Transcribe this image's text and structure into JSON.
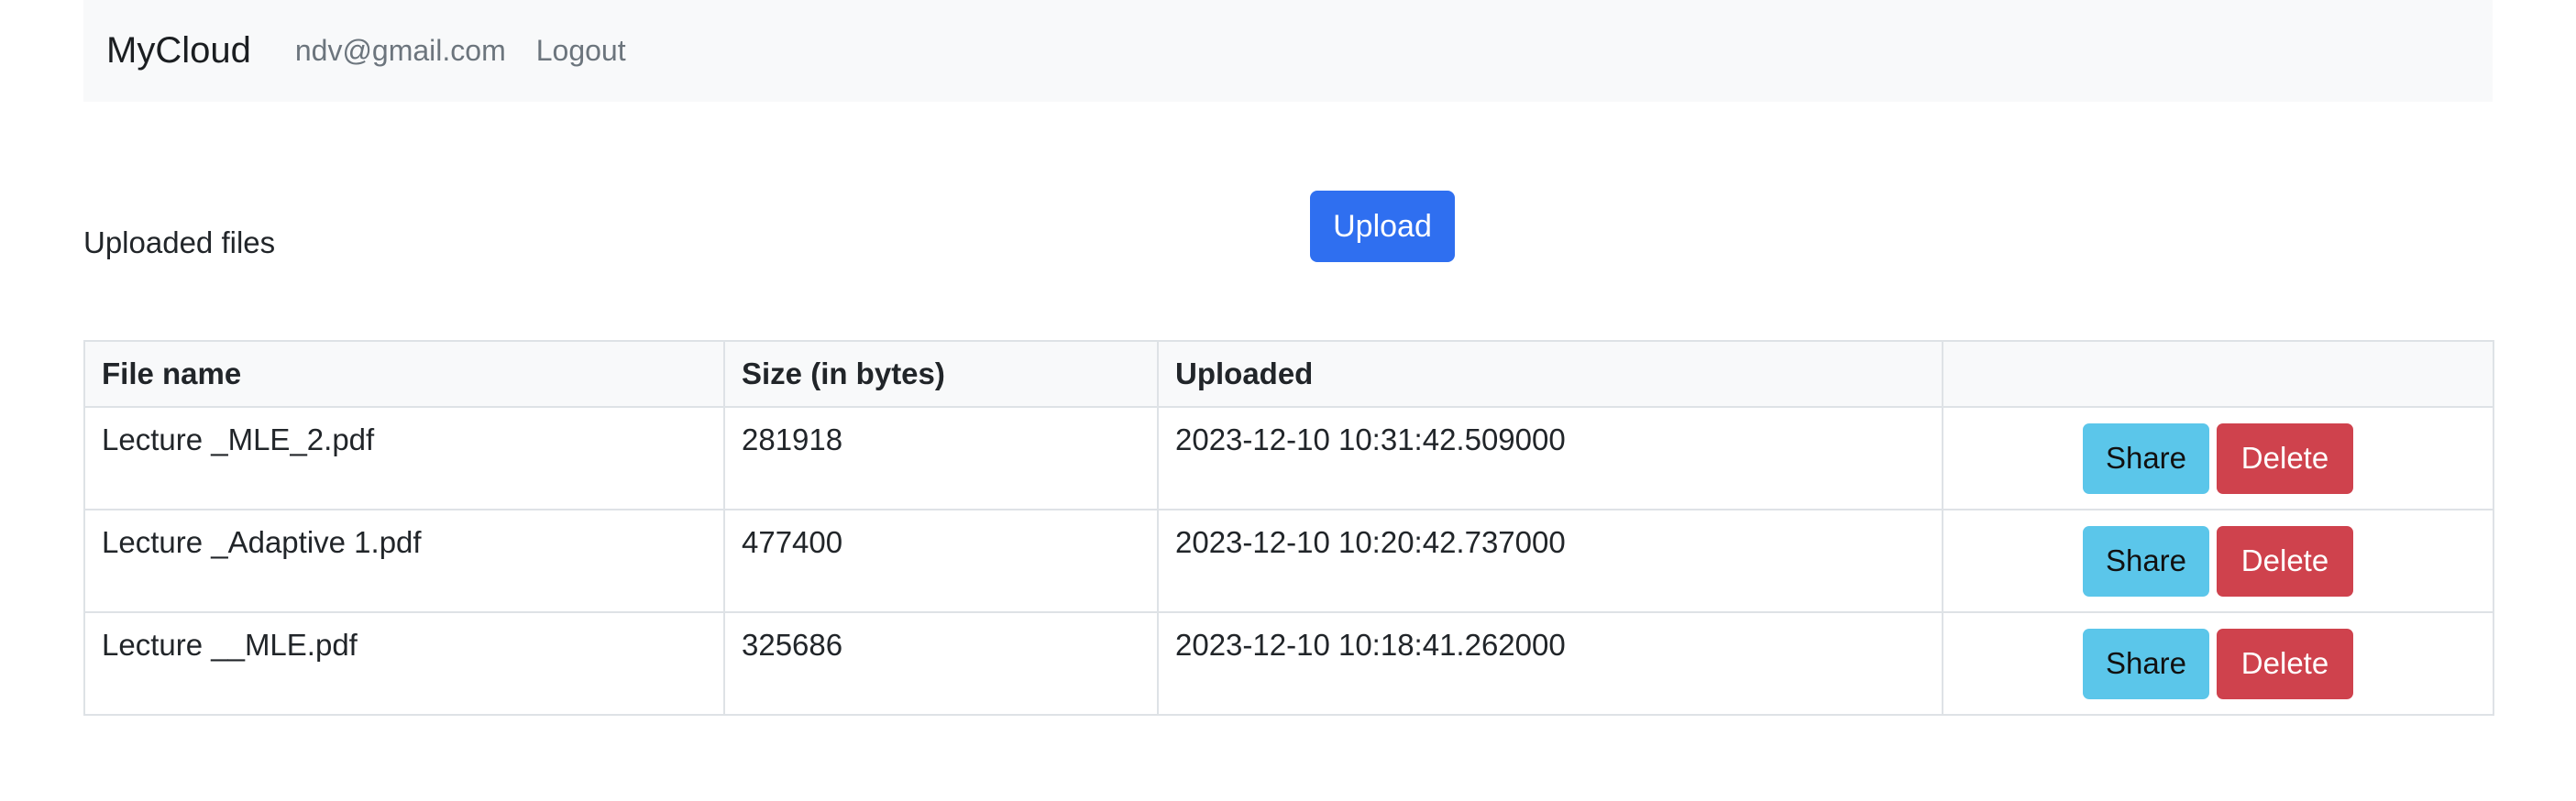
{
  "navbar": {
    "brand": "MyCloud",
    "user_email": "ndv@gmail.com",
    "logout_label": "Logout"
  },
  "main": {
    "section_title": "Uploaded files",
    "upload_label": "Upload"
  },
  "table": {
    "headers": {
      "name": "File name",
      "size": "Size (in bytes)",
      "uploaded": "Uploaded",
      "actions": ""
    },
    "rows": [
      {
        "name": "Lecture _MLE_2.pdf",
        "size": "281918",
        "uploaded": "2023-12-10 10:31:42.509000"
      },
      {
        "name": "Lecture _Adaptive 1.pdf",
        "size": "477400",
        "uploaded": "2023-12-10 10:20:42.737000"
      },
      {
        "name": "Lecture __MLE.pdf",
        "size": "325686",
        "uploaded": "2023-12-10 10:18:41.262000"
      }
    ],
    "share_label": "Share",
    "delete_label": "Delete"
  },
  "colors": {
    "primary": "#2f6ff0",
    "info": "#5bc6ea",
    "danger": "#cf424d",
    "navbar_bg": "#f8f9fa"
  }
}
